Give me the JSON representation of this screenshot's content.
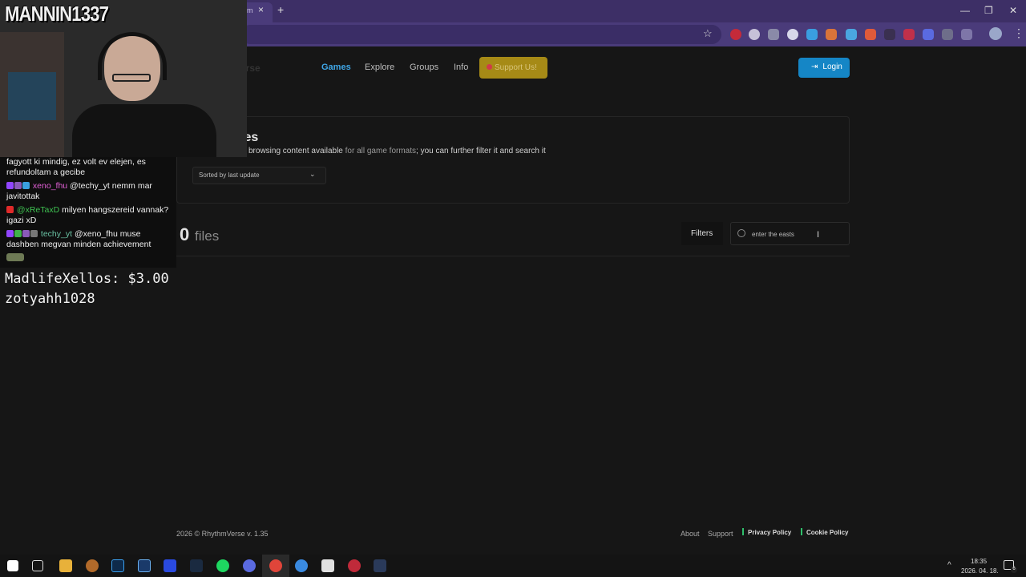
{
  "browser": {
    "tab_title": "m",
    "tab_close": "×",
    "new_tab": "+",
    "window": {
      "minimize": "—",
      "restore": "❐",
      "close": "✕"
    },
    "star": "☆",
    "menu": "⋮"
  },
  "site": {
    "logo_partial": "erse",
    "nav": {
      "games": "Games",
      "explore": "Explore",
      "groups": "Groups",
      "info": "Info"
    },
    "support_label": "Support Us!",
    "login_label": "Login",
    "accent_color": "#3fa7e8"
  },
  "files_panel": {
    "title_partial": "les",
    "desc_partial": "ly browsing content available",
    "desc_highlight": "for all game formats",
    "desc_tail": "; you can further filter it and search it",
    "sort_value": "Sorted by last update"
  },
  "results": {
    "count": "0",
    "label": "files",
    "filters_label": "Filters",
    "search_value": "enter the easts"
  },
  "footer": {
    "copyright": "2026  © RhythmVerse v. 1.35",
    "about": "About",
    "support": "Support",
    "privacy": "Privacy Policy",
    "cookie": "Cookie Policy"
  },
  "overlay": {
    "streamer": "MANNIN1337",
    "chat": [
      {
        "text": "fagyott ki mindig, ez volt ev elejen, es refundoltam a gecibe"
      },
      {
        "user": "xeno_fhu",
        "text": " @techy_yt nemm mar javitottak"
      },
      {
        "user": "@xReTaxD",
        "text": " milyen hangszereid vannak? igazi xD"
      },
      {
        "user": "techy_yt",
        "text": " @xeno_fhu muse dashben megvan minden achievement"
      }
    ],
    "donations": [
      "MadlifeXellos: $3.00",
      "zotyahh1028"
    ]
  },
  "taskbar": {
    "time": "18:35",
    "date": "2026. 04. 18.",
    "notification_count": "6",
    "tray_chevron": "^"
  }
}
